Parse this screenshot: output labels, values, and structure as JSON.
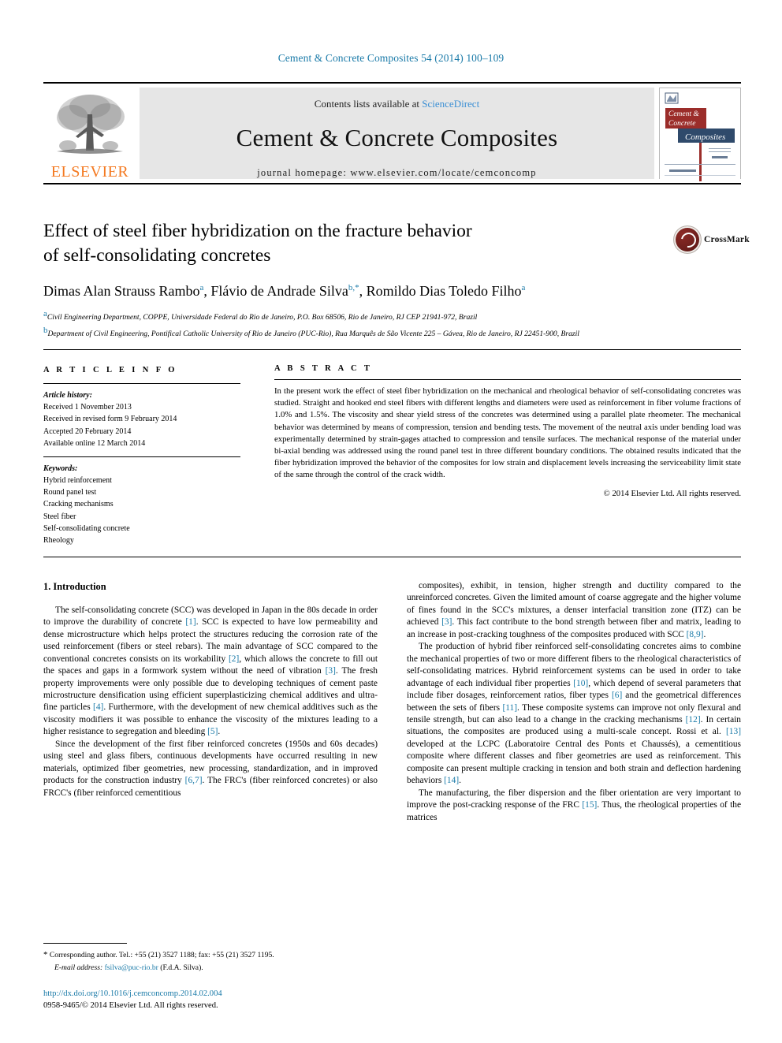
{
  "running_head": "Cement & Concrete Composites 54 (2014) 100–109",
  "masthead": {
    "publisher_name": "ELSEVIER",
    "contents_prefix": "Contents lists available at ",
    "contents_link": "ScienceDirect",
    "journal_title": "Cement & Concrete Composites",
    "journal_homepage": "journal homepage: www.elsevier.com/locate/cemconcomp",
    "cover": {
      "line1": "Cement &",
      "line2": "Concrete",
      "line3": "Composites",
      "red": "#9b2d2a",
      "navy": "#2f4a6b"
    }
  },
  "article": {
    "title_line1": "Effect of steel fiber hybridization on the fracture behavior",
    "title_line2": "of self-consolidating concretes",
    "authors": [
      {
        "name": "Dimas Alan Strauss Rambo",
        "marks": "a"
      },
      {
        "name": "Flávio de Andrade Silva",
        "marks": "b,*"
      },
      {
        "name": "Romildo Dias Toledo Filho",
        "marks": "a"
      }
    ],
    "affiliations": [
      {
        "mark": "a",
        "text": "Civil Engineering Department, COPPE, Universidade Federal do Rio de Janeiro, P.O. Box 68506, Rio de Janeiro, RJ CEP 21941-972, Brazil"
      },
      {
        "mark": "b",
        "text": "Department of Civil Engineering, Pontifical Catholic University of Rio de Janeiro (PUC-Rio), Rua Marquês de São Vicente 225 – Gávea, Rio de Janeiro, RJ 22451-900, Brazil"
      }
    ],
    "crossmark_label": "CrossMark"
  },
  "info": {
    "heading": "A R T I C L E   I N F O",
    "history_label": "Article history:",
    "history": [
      "Received 1 November 2013",
      "Received in revised form 9 February 2014",
      "Accepted 20 February 2014",
      "Available online 12 March 2014"
    ],
    "keywords_label": "Keywords:",
    "keywords": [
      "Hybrid reinforcement",
      "Round panel test",
      "Cracking mechanisms",
      "Steel fiber",
      "Self-consolidating concrete",
      "Rheology"
    ]
  },
  "abstract": {
    "heading": "A B S T R A C T",
    "text": "In the present work the effect of steel fiber hybridization on the mechanical and rheological behavior of self-consolidating concretes was studied. Straight and hooked end steel fibers with different lengths and diameters were used as reinforcement in fiber volume fractions of 1.0% and 1.5%. The viscosity and shear yield stress of the concretes was determined using a parallel plate rheometer. The mechanical behavior was determined by means of compression, tension and bending tests. The movement of the neutral axis under bending load was experimentally determined by strain-gages attached to compression and tensile surfaces. The mechanical response of the material under bi-axial bending was addressed using the round panel test in three different boundary conditions. The obtained results indicated that the fiber hybridization improved the behavior of the composites for low strain and displacement levels increasing the serviceability limit state of the same through the control of the crack width.",
    "copyright": "© 2014 Elsevier Ltd. All rights reserved."
  },
  "intro": {
    "heading": "1. Introduction",
    "left_paragraphs": [
      "The self-consolidating concrete (SCC) was developed in Japan in the 80s decade in order to improve the durability of concrete [1]. SCC is expected to have low permeability and dense microstructure which helps protect the structures reducing the corrosion rate of the used reinforcement (fibers or steel rebars). The main advantage of SCC compared to the conventional concretes consists on its workability [2], which allows the concrete to fill out the spaces and gaps in a formwork system without the need of vibration [3]. The fresh property improvements were only possible due to developing techniques of cement paste microstructure densification using efficient superplasticizing chemical additives and ultra-fine particles [4]. Furthermore, with the development of new chemical additives such as the viscosity modifiers it was possible to enhance the viscosity of the mixtures leading to a higher resistance to segregation and bleeding [5].",
      "Since the development of the first fiber reinforced concretes (1950s and 60s decades) using steel and glass fibers, continuous developments have occurred resulting in new materials, optimized fiber geometries, new processing, standardization, and in improved products for the construction industry [6,7]. The FRC's (fiber reinforced concretes) or also FRCC's (fiber reinforced cementitious"
    ],
    "right_paragraphs": [
      "composites), exhibit, in tension, higher strength and ductility compared to the unreinforced concretes. Given the limited amount of coarse aggregate and the higher volume of fines found in the SCC's mixtures, a denser interfacial transition zone (ITZ) can be achieved [3]. This fact contribute to the bond strength between fiber and matrix, leading to an increase in post-cracking toughness of the composites produced with SCC [8,9].",
      "The production of hybrid fiber reinforced self-consolidating concretes aims to combine the mechanical properties of two or more different fibers to the rheological characteristics of self-consolidating matrices. Hybrid reinforcement systems can be used in order to take advantage of each individual fiber properties [10], which depend of several parameters that include fiber dosages, reinforcement ratios, fiber types [6] and the geometrical differences between the sets of fibers [11]. These composite systems can improve not only flexural and tensile strength, but can also lead to a change in the cracking mechanisms [12]. In certain situations, the composites are produced using a multi-scale concept. Rossi et al. [13] developed at the LCPC (Laboratoire Central des Ponts et Chaussés), a cementitious composite where different classes and fiber geometries are used as reinforcement. This composite can present multiple cracking in tension and both strain and deflection hardening behaviors [14].",
      "The manufacturing, the fiber dispersion and the fiber orientation are very important to improve the post-cracking response of the FRC [15]. Thus, the rheological properties of the matrices"
    ]
  },
  "footnote": {
    "marker": "*",
    "corresponding": "Corresponding author. Tel.: +55 (21) 3527 1188; fax: +55 (21) 3527 1195.",
    "email_label": "E-mail address:",
    "email": "fsilva@puc-rio.br",
    "email_owner": "(F.d.A. Silva)."
  },
  "footer": {
    "doi": "http://dx.doi.org/10.1016/j.cemconcomp.2014.02.004",
    "issn_line": "0958-9465/© 2014 Elsevier Ltd. All rights reserved."
  },
  "colors": {
    "link": "#1a7aa8",
    "sciencedirect": "#3b8fd4",
    "elsevier_orange": "#f47920"
  }
}
